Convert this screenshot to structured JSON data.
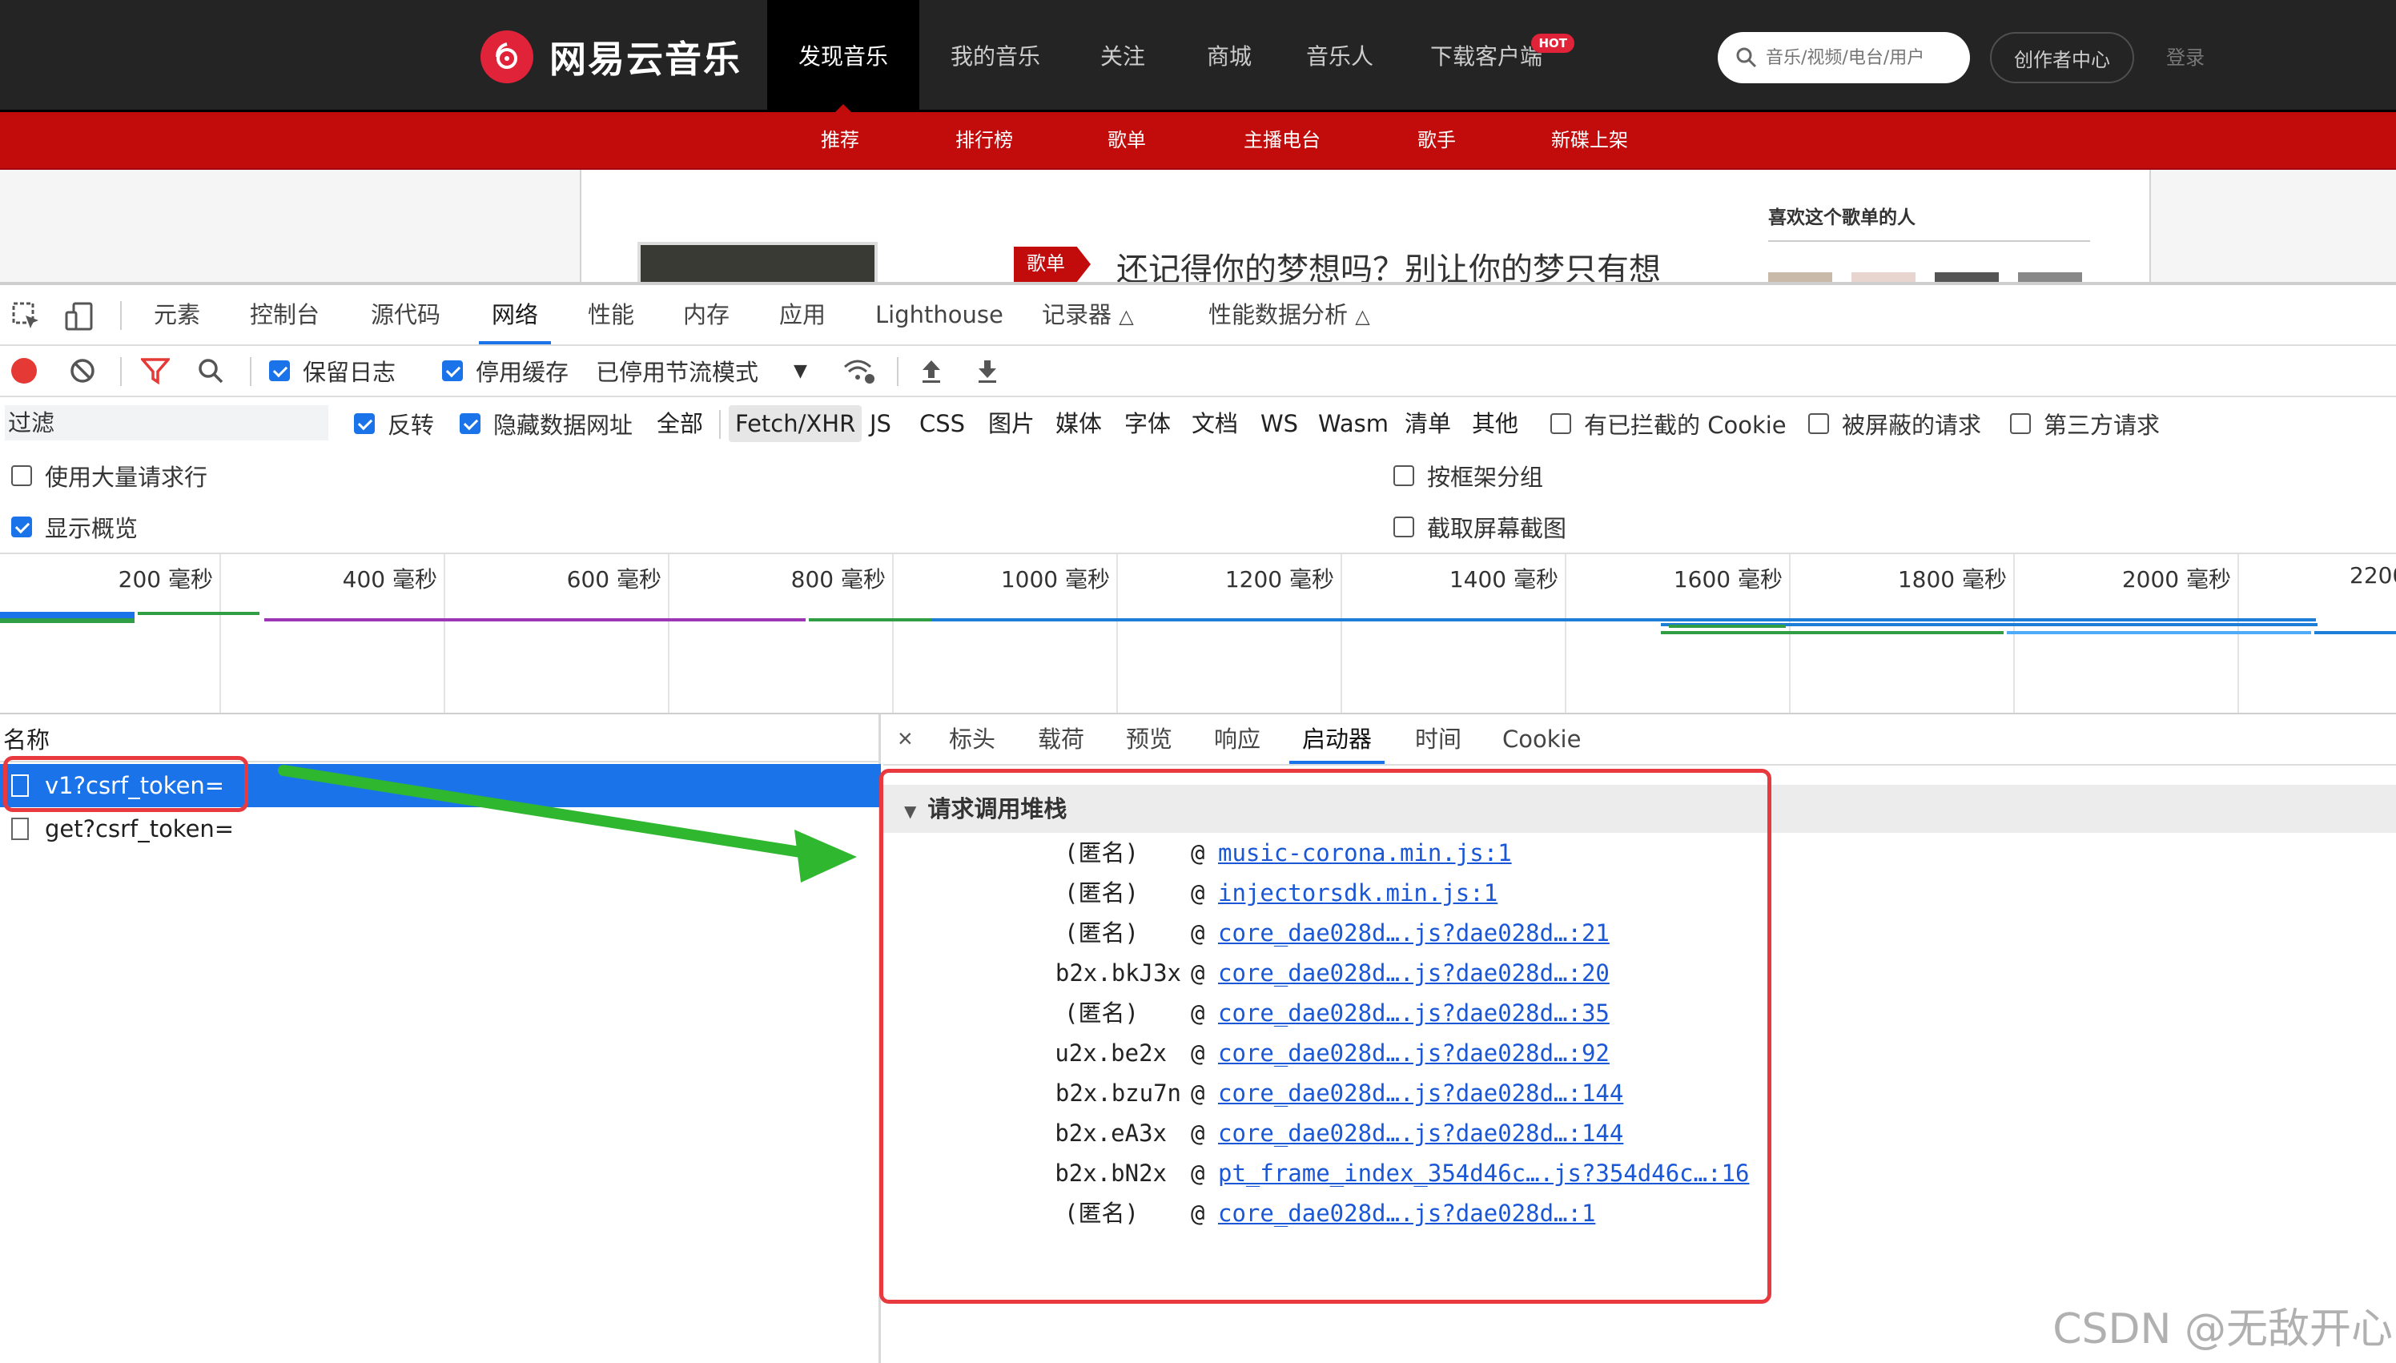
{
  "site": {
    "logo_text": "网易云音乐",
    "nav": [
      "发现音乐",
      "我的音乐",
      "关注",
      "商城",
      "音乐人",
      "下载客户端"
    ],
    "hot_badge": "HOT",
    "search_placeholder": "音乐/视频/电台/用户",
    "creator_center": "创作者中心",
    "login": "登录",
    "subnav": [
      "推荐",
      "排行榜",
      "歌单",
      "主播电台",
      "歌手",
      "新碟上架"
    ],
    "playlist_tag": "歌单",
    "playlist_title": "还记得你的梦想吗？别让你的梦只有想",
    "side_heading": "喜欢这个歌单的人"
  },
  "devtools": {
    "tabs": [
      "元素",
      "控制台",
      "源代码",
      "网络",
      "性能",
      "内存",
      "应用",
      "Lighthouse",
      "记录器",
      "性能数据分析"
    ],
    "active_tab": "网络",
    "toolbar": {
      "preserve_log": "保留日志",
      "disable_cache": "停用缓存",
      "throttling": "已停用节流模式"
    },
    "filter": {
      "placeholder": "过滤",
      "invert": "反转",
      "hide_data_urls": "隐藏数据网址",
      "types": [
        "全部",
        "Fetch/XHR",
        "JS",
        "CSS",
        "图片",
        "媒体",
        "字体",
        "文档",
        "WS",
        "Wasm",
        "清单",
        "其他"
      ],
      "active_type": "Fetch/XHR",
      "blocked_cookies": "有已拦截的 Cookie",
      "blocked_requests": "被屏蔽的请求",
      "third_party": "第三方请求"
    },
    "options": {
      "big_rows": "使用大量请求行",
      "group_by_frame": "按框架分组",
      "show_overview": "显示概览",
      "capture_screenshots": "截取屏幕截图"
    },
    "timeline_labels": [
      "200 毫秒",
      "400 毫秒",
      "600 毫秒",
      "800 毫秒",
      "1000 毫秒",
      "1200 毫秒",
      "1400 毫秒",
      "1600 毫秒",
      "1800 毫秒",
      "2000 毫秒",
      "2200"
    ],
    "requests": {
      "header": "名称",
      "items": [
        "v1?csrf_token=",
        "get?csrf_token="
      ]
    },
    "detail_tabs": [
      "标头",
      "载荷",
      "预览",
      "响应",
      "启动器",
      "时间",
      "Cookie"
    ],
    "active_detail_tab": "启动器",
    "stack_title": "请求调用堆栈",
    "stack": [
      {
        "fn": "(匿名)",
        "src": "music-corona.min.js:1"
      },
      {
        "fn": "(匿名)",
        "src": "injectorsdk.min.js:1"
      },
      {
        "fn": "(匿名)",
        "src": "core_dae028d….js?dae028d…:21"
      },
      {
        "fn": "b2x.bkJ3x",
        "src": "core_dae028d….js?dae028d…:20"
      },
      {
        "fn": "(匿名)",
        "src": "core_dae028d….js?dae028d…:35"
      },
      {
        "fn": "u2x.be2x",
        "src": "core_dae028d….js?dae028d…:92"
      },
      {
        "fn": "b2x.bzu7n",
        "src": "core_dae028d….js?dae028d…:144"
      },
      {
        "fn": "b2x.eA3x",
        "src": "core_dae028d….js?dae028d…:144"
      },
      {
        "fn": "b2x.bN2x",
        "src": "pt_frame_index_354d46c….js?354d46c…:16"
      },
      {
        "fn": "(匿名)",
        "src": "core_dae028d….js?dae028d…:1"
      }
    ]
  },
  "watermark": "CSDN @无敌开心",
  "colors": {
    "brand_red": "#c20c0c",
    "devtools_blue": "#1a73e8",
    "annotation_red": "#e8393f",
    "annotation_green": "#2fb82f"
  }
}
